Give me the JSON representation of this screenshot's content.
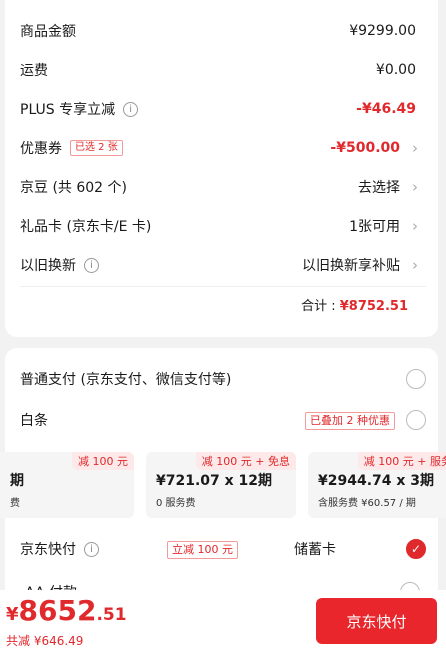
{
  "summary": {
    "goods": {
      "label": "商品金额",
      "value": "¥9299.00"
    },
    "shipping": {
      "label": "运费",
      "value": "¥0.00"
    },
    "plus": {
      "label": "PLUS 专享立减",
      "value": "-¥46.49"
    },
    "coupon": {
      "label": "优惠券",
      "tag": "已选 2 张",
      "value": "-¥500.00"
    },
    "jingdou": {
      "label": "京豆 (共 602 个)",
      "value": "去选择"
    },
    "giftcard": {
      "label": "礼品卡 (京东卡/E 卡)",
      "value": "1张可用"
    },
    "tradein": {
      "label": "以旧换新",
      "value": "以旧换新享补贴"
    },
    "total_label": "合计 :",
    "total_value": "¥8752.51"
  },
  "payment": {
    "normal": {
      "label": "普通支付 (京东支付、微信支付等)"
    },
    "baitiao": {
      "label": "白条",
      "tag": "已叠加 2 种优惠"
    },
    "plans": [
      {
        "badge": "减 100 元",
        "amount": "期",
        "fee": "费"
      },
      {
        "badge": "减 100 元 + 免息",
        "amount": "¥721.07 x 12期",
        "fee": "0 服务费"
      },
      {
        "badge": "减 100 元 + 服务",
        "amount": "¥2944.74 x 3期",
        "fee": "含服务费 ¥60.57 / 期"
      }
    ],
    "quickpay": {
      "label": "京东快付",
      "tag": "立减 100 元",
      "card": "储蓄卡"
    },
    "aa": {
      "label": "AA 付款"
    }
  },
  "footer": {
    "currency": "¥",
    "price_int": "8652",
    "price_dec": ".51",
    "saved": "共减 ¥646.49",
    "button": "京东快付"
  },
  "colors": {
    "accent": "#e0292c"
  }
}
